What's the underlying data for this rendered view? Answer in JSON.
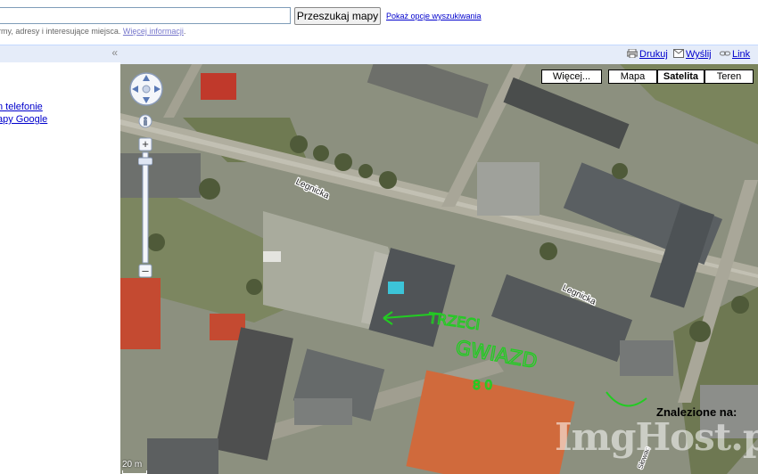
{
  "search": {
    "value": "",
    "button_label": "Przeszukaj mapy",
    "options_link": "Pokaż opcje wyszukiwania",
    "hint_text": "rmy, adresy i interesujące miejsca.",
    "hint_more": "Więcej informacji",
    "hint_period": "."
  },
  "left_panel": {
    "collapse_label": "«",
    "links": [
      "n telefonie",
      "apy Google"
    ]
  },
  "toolbar": {
    "print": "Drukuj",
    "send": "Wyślij",
    "link": "Link"
  },
  "map": {
    "more_label": "Więcej...",
    "map_label": "Mapa",
    "satellite_label": "Satelita",
    "terrain_label": "Teren",
    "active_type": "Satelita",
    "street_labels": [
      "Legnicka",
      "Legnicka"
    ],
    "handwriting": [
      "TRZECI",
      "GWIAZD",
      "8 0"
    ],
    "scale_label": "20 m",
    "found_on": "Znalezione na:",
    "watermark": "ImgHost.pl",
    "street_label_small": "Słowac"
  },
  "colors": {
    "link_blue": "#0000cc",
    "toolbar_bg": "#e5ecf9",
    "annotation_green": "#22cc22",
    "roof_red": "#c84a30",
    "roof_orange": "#d06a3c"
  }
}
